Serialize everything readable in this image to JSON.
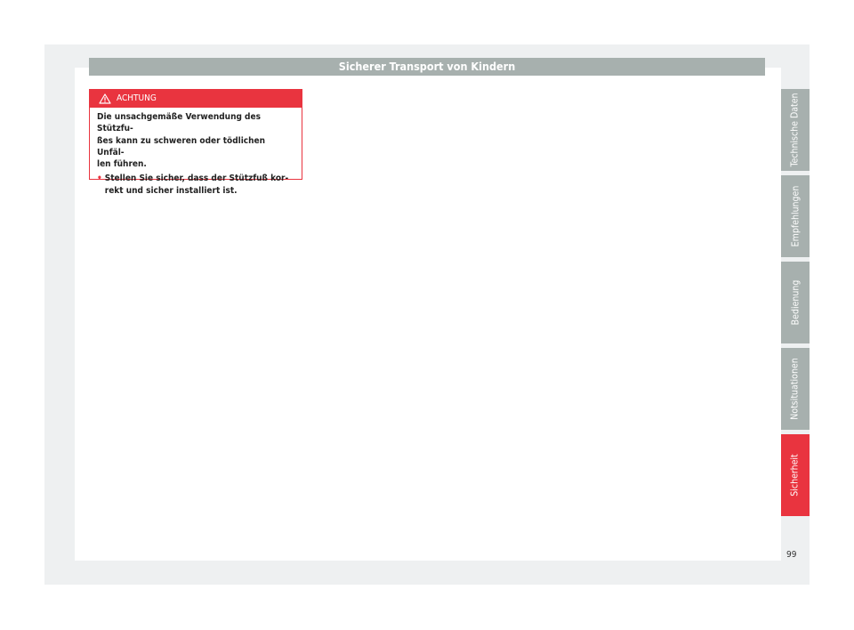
{
  "header": {
    "title": "Sicherer Transport von Kindern"
  },
  "warning": {
    "label": "ACHTUNG",
    "text_lines": [
      "Die unsachgemäße Verwendung des Stützfu-",
      "ßes kann zu schweren oder tödlichen Unfäl-",
      "len führen."
    ],
    "bullet_lines": [
      "Stellen Sie sicher, dass der Stützfuß kor-",
      "rekt und sicher installiert ist."
    ],
    "bullet_symbol": "•"
  },
  "side_tabs": [
    {
      "label": "Technische Daten",
      "active": false
    },
    {
      "label": "Empfehlungen",
      "active": false
    },
    {
      "label": "Bedienung",
      "active": false
    },
    {
      "label": "Notsituationen",
      "active": false
    },
    {
      "label": "Sicherheit",
      "active": true
    }
  ],
  "page_number": "99",
  "colors": {
    "accent": "#e9343f",
    "tab_gray": "#a7b0ae",
    "background": "#eef0f1"
  }
}
